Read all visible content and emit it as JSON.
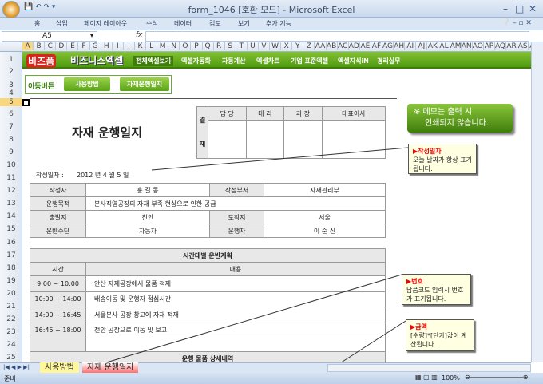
{
  "window": {
    "title": "form_1046  [호환 모드] - Microsoft Excel"
  },
  "ribbon": {
    "tabs": [
      "홈",
      "삽입",
      "페이지 레이아웃",
      "수식",
      "데이터",
      "검토",
      "보기",
      "추가 기능"
    ]
  },
  "formula": {
    "name_box": "A5",
    "fx": "fx",
    "value": ""
  },
  "columns": [
    "A",
    "B",
    "C",
    "D",
    "E",
    "F",
    "G",
    "H",
    "I",
    "J",
    "K",
    "L",
    "M",
    "N",
    "O",
    "P",
    "Q",
    "R",
    "S",
    "T",
    "U",
    "V",
    "W",
    "X",
    "Y",
    "Z",
    "AA",
    "AB",
    "AC",
    "AD",
    "AE",
    "AF",
    "AG",
    "AH",
    "AI",
    "AJ",
    "AK",
    "AL",
    "AM",
    "AN",
    "AO",
    "AP",
    "AQ",
    "AR",
    "AS",
    "AT"
  ],
  "rows": [
    "1",
    "2",
    "3",
    "4",
    "5",
    "6",
    "7",
    "8",
    "9",
    "10",
    "11",
    "12",
    "13",
    "14",
    "15",
    "16",
    "17",
    "18",
    "19",
    "20",
    "21",
    "22",
    "23",
    "24",
    "25"
  ],
  "banner": {
    "logo1": "비즈폼",
    "logo2": "비즈니스엑셀",
    "nav": [
      "전체엑셀보기",
      "엑셀자동화",
      "자동계산",
      "엑셀차트",
      "기업 표준엑셀",
      "엑셀지식iN",
      "경리실무"
    ]
  },
  "move": {
    "label": "이동버튼",
    "buttons": [
      "사용방법",
      "자재운행일지"
    ]
  },
  "doc": {
    "title": "자재 운행일지",
    "approval": {
      "side": [
        "결",
        "재"
      ],
      "headers": [
        "담 당",
        "대 리",
        "과 장",
        "대표이사"
      ]
    },
    "date_label": "작성일자 :",
    "date": "2012 년  4 월  5 일",
    "info": [
      [
        "작성자",
        "홍 길 동",
        "작성부서",
        "자재관리부"
      ],
      [
        "운행목적",
        "본사직영공장의 자재 부족 현상으로 인한 공급"
      ],
      [
        "출발지",
        "천안",
        "도착지",
        "서울"
      ],
      [
        "운반수단",
        "자동차",
        "운행자",
        "이 순 신"
      ]
    ],
    "schedule": {
      "title": "시간대별 운반계획",
      "headers": [
        "시간",
        "내용"
      ],
      "rows": [
        [
          "9:00 ~ 10:00",
          "안산 자재공장에서 물품 적재"
        ],
        [
          "10:00 ~ 14:00",
          "배송이동 및 운행자 점심시간"
        ],
        [
          "14:00 ~ 16:45",
          "서울본사 공장 창고에 자재 적재"
        ],
        [
          "16:45 ~ 18:00",
          "천안 공장으로 이동 및 보고"
        ],
        [
          "",
          ""
        ]
      ]
    },
    "detail_title": "운행 물품 상세내역"
  },
  "memo": {
    "line1": "※ 메모는 출력 시",
    "line2": "인쇄되지 않습니다."
  },
  "notes": [
    {
      "title": "▶작성일자",
      "text": "오늘 날짜가 항상 표기됩니다."
    },
    {
      "title": "▶번호",
      "text": "납품코드 입력시 번호가 표기됩니다."
    },
    {
      "title": "▶금액",
      "text": "[수량]*[단가]값이 계산됩니다."
    }
  ],
  "sheets": [
    "사용방법",
    "자재 운행일지"
  ],
  "status": {
    "ready": "준비",
    "zoom": "100%"
  },
  "colors": {
    "green": "#5aa415",
    "tab_yellow": "#fff799",
    "tab_red": "#ff6d6d"
  }
}
